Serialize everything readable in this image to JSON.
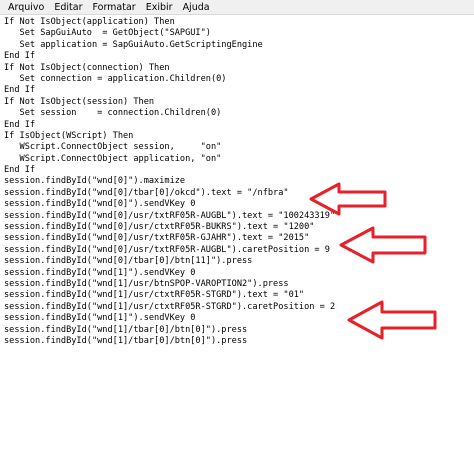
{
  "menubar": {
    "items": [
      "Arquivo",
      "Editar",
      "Formatar",
      "Exibir",
      "Ajuda"
    ]
  },
  "editor": {
    "lines": [
      "If Not IsObject(application) Then",
      "   Set SapGuiAuto  = GetObject(\"SAPGUI\")",
      "   Set application = SapGuiAuto.GetScriptingEngine",
      "End If",
      "If Not IsObject(connection) Then",
      "   Set connection = application.Children(0)",
      "End If",
      "If Not IsObject(session) Then",
      "   Set session    = connection.Children(0)",
      "End If",
      "If IsObject(WScript) Then",
      "   WScript.ConnectObject session,     \"on\"",
      "   WScript.ConnectObject application, \"on\"",
      "End If",
      "session.findById(\"wnd[0]\").maximize",
      "session.findById(\"wnd[0]/tbar[0]/okcd\").text = \"/nfbra\"",
      "session.findById(\"wnd[0]\").sendVKey 0",
      "session.findById(\"wnd[0]/usr/txtRF05R-AUGBL\").text = \"100243319\"",
      "session.findById(\"wnd[0]/usr/ctxtRF05R-BUKRS\").text = \"1200\"",
      "session.findById(\"wnd[0]/usr/txtRF05R-GJAHR\").text = \"2015\"",
      "session.findById(\"wnd[0]/usr/txtRF05R-AUGBL\").caretPosition = 9",
      "session.findById(\"wnd[0]/tbar[0]/btn[11]\").press",
      "session.findById(\"wnd[1]\").sendVKey 0",
      "session.findById(\"wnd[1]/usr/btnSPOP-VAROPTION2\").press",
      "session.findById(\"wnd[1]/usr/ctxtRF05R-STGRD\").text = \"01\"",
      "session.findById(\"wnd[1]/usr/ctxtRF05R-STGRD\").caretPosition = 2",
      "session.findById(\"wnd[1]\").sendVKey 0",
      "session.findById(\"wnd[1]/tbar[0]/btn[0]\").press",
      "session.findById(\"wnd[1]/tbar[0]/btn[0]\").press"
    ]
  },
  "annotations": {
    "arrow_color": "#e8202a",
    "arrow_icon": "left-arrow-outline-icon",
    "count": 3
  }
}
